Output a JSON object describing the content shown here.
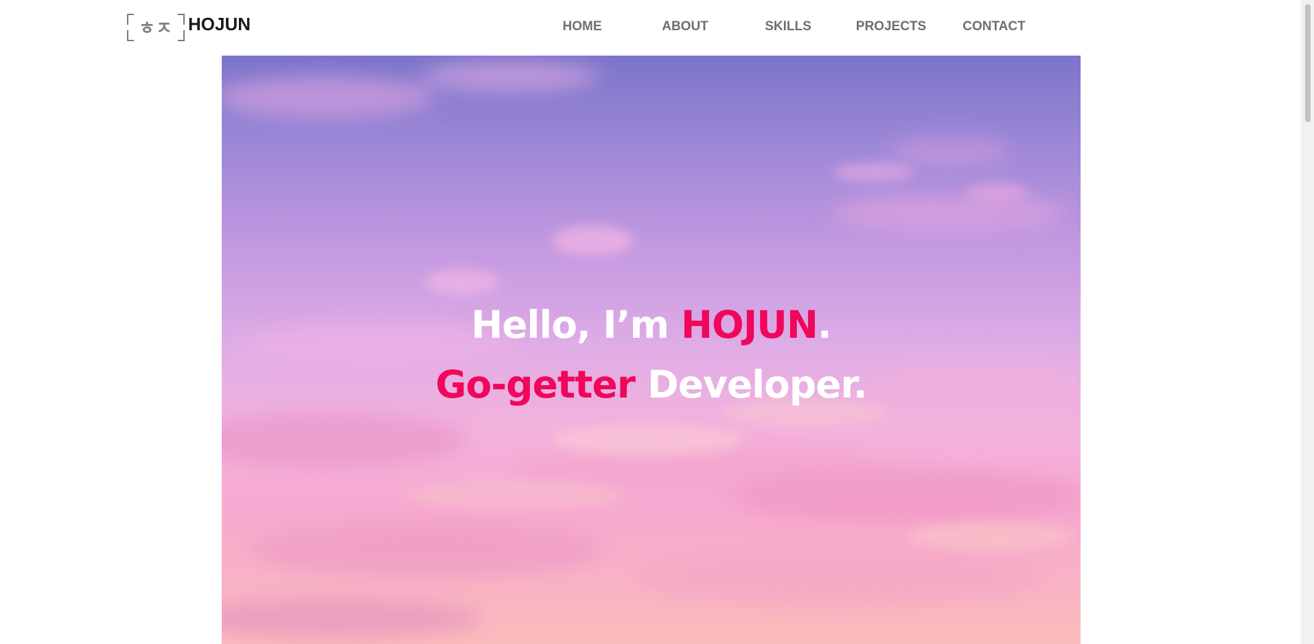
{
  "header": {
    "logo": {
      "glyph": "ㅎㅈ",
      "text": "HOJUN"
    },
    "nav": [
      {
        "label": "HOME"
      },
      {
        "label": "ABOUT"
      },
      {
        "label": "SKILLS"
      },
      {
        "label": "PROJECTS"
      },
      {
        "label": "CONTACT"
      }
    ]
  },
  "hero": {
    "line1": {
      "prefix": "Hello, I’m ",
      "name": "HOJUN",
      "suffix": "."
    },
    "line2": {
      "highlight": "Go-getter",
      "rest": " Developer."
    }
  },
  "colors": {
    "accent": "#f0065a",
    "nav_text": "#6e6e6e",
    "logo_text": "#1a1a1a"
  }
}
